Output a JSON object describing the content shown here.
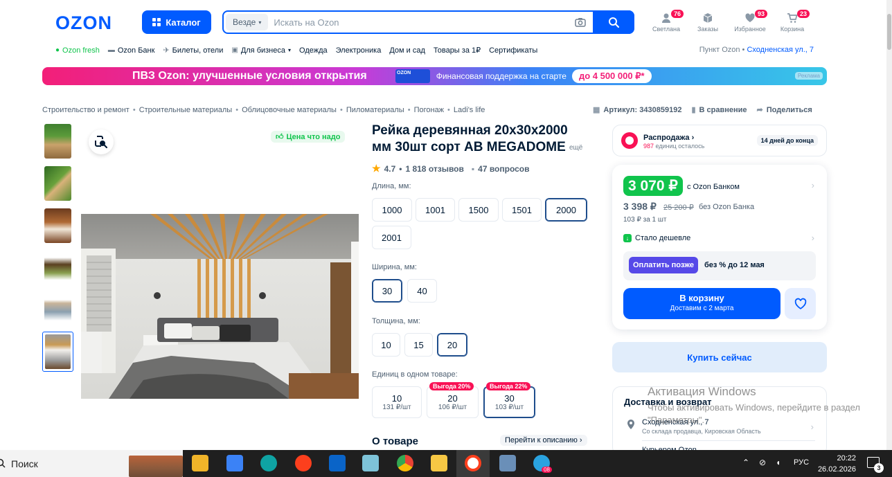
{
  "header": {
    "logo": "OZON",
    "catalog_label": "Каталог",
    "search_scope": "Везде",
    "search_placeholder": "Искать на Ozon",
    "actions": [
      {
        "label": "Светлана",
        "badge": "76"
      },
      {
        "label": "Заказы",
        "badge": ""
      },
      {
        "label": "Избранное",
        "badge": "93"
      },
      {
        "label": "Корзина",
        "badge": "23"
      }
    ]
  },
  "nav": {
    "items": [
      "Ozon fresh",
      "Ozon Банк",
      "Билеты, отели",
      "Для бизнеса",
      "Одежда",
      "Электроника",
      "Дом и сад",
      "Товары за 1₽",
      "Сертификаты"
    ],
    "pickup_label": "Пункт Ozon",
    "pickup_address": "Сходненская ул., 7"
  },
  "banner": {
    "title": "ПВЗ Ozon: улучшенные условия открытия",
    "box_label": "OZON",
    "subtitle": "Финансовая поддержка на старте",
    "amount": "до 4 500 000 ₽*",
    "ad_label": "Реклама"
  },
  "breadcrumbs": [
    "Строительство и ремонт",
    "Строительные материалы",
    "Облицовочные материалы",
    "Пиломатериалы",
    "Погонаж",
    "Ladi's life"
  ],
  "meta": {
    "article": "Артикул: 3430859192",
    "compare": "В сравнение",
    "share": "Поделиться"
  },
  "gallery": {
    "price_tag": "Цена что надо"
  },
  "product": {
    "title": "Рейка деревянная 20х30х2000 мм 30шт сорт АВ MEGADOME",
    "more": "ещё",
    "rating": "4.7",
    "reviews": "1 818 отзывов",
    "questions": "47 вопросов",
    "length_label": "Длина, мм:",
    "lengths": [
      "1000",
      "1001",
      "1500",
      "1501",
      "2000",
      "2001"
    ],
    "length_selected": "2000",
    "width_label": "Ширина, мм:",
    "widths": [
      "30",
      "40"
    ],
    "width_selected": "30",
    "thickness_label": "Толщина, мм:",
    "thicknesses": [
      "10",
      "15",
      "20"
    ],
    "thickness_selected": "20",
    "units_label": "Единиц в одном товаре:",
    "units": [
      {
        "count": "10",
        "price": "131 ₽/шт",
        "benefit": ""
      },
      {
        "count": "20",
        "price": "106 ₽/шт",
        "benefit": "Выгода 20%"
      },
      {
        "count": "30",
        "price": "103 ₽/шт",
        "benefit": "Выгода 22%"
      }
    ],
    "about_title": "О товаре",
    "goto_description": "Перейти к описанию"
  },
  "sale": {
    "title": "Распродажа",
    "count": "987",
    "count_suffix": "единиц осталось",
    "days_left": "14 дней до конца"
  },
  "price": {
    "bank_price": "3 070 ₽",
    "bank_label": "с Ozon Банком",
    "regular_price": "3 398 ₽",
    "old_price": "25 200 ₽",
    "regular_label": "без Ozon Банка",
    "per_unit": "103 ₽ за 1 шт",
    "cheaper": "Стало дешевле",
    "pay_later": "Оплатить позже",
    "pay_later_terms": "без % до 12 мая",
    "cart_label": "В корзину",
    "cart_sub": "Доставим с 2 марта",
    "buy_now": "Купить сейчас"
  },
  "delivery": {
    "title": "Доставка и возврат",
    "address": "Сходненская ул., 7",
    "address_sub": "Со склада продавца, Кировская Область",
    "courier": "Курьером Ozon"
  },
  "windows": {
    "activate_title": "Активация Windows",
    "activate_text": "Чтобы активировать Windows, перейдите в раздел \"Параметры\"."
  },
  "taskbar": {
    "search": "Поиск",
    "lang": "РУС",
    "time": "20:22",
    "date": "26.02.2026",
    "notifications": "3",
    "telegram_badge": "08"
  },
  "colors": {
    "brand": "#005bff",
    "sale_pink": "#f91155",
    "price_green": "#10c44c",
    "pay_later": "#5649e8"
  }
}
